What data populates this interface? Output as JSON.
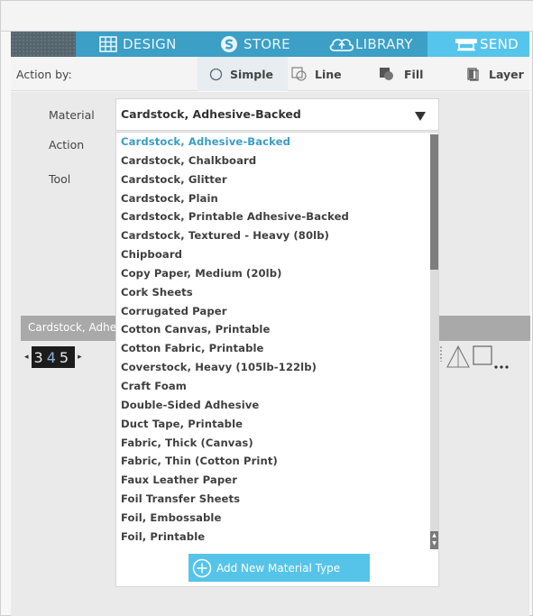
{
  "tabs": [
    {
      "label": "DESIGN",
      "icon": "grid-icon"
    },
    {
      "label": "STORE",
      "icon": "store-icon"
    },
    {
      "label": "LIBRARY",
      "icon": "cloud-icon"
    },
    {
      "label": "SEND",
      "icon": "cutter-icon",
      "active": true
    }
  ],
  "action_bar": {
    "label": "Action by:",
    "options": [
      {
        "label": "Simple",
        "icon": "circle-icon",
        "selected": true
      },
      {
        "label": "Line",
        "icon": "line-icon"
      },
      {
        "label": "Fill",
        "icon": "fill-icon"
      },
      {
        "label": "Layer",
        "icon": "layer-icon"
      }
    ]
  },
  "form": {
    "material_label": "Material",
    "action_label": "Action",
    "tool_label": "Tool",
    "material_value": "Cardstock, Adhesive-Backed"
  },
  "dropdown": {
    "items": [
      "Cardstock, Adhesive-Backed",
      "Cardstock, Chalkboard",
      "Cardstock, Glitter",
      "Cardstock, Plain",
      "Cardstock, Printable Adhesive-Backed",
      "Cardstock, Textured - Heavy (80lb)",
      "Chipboard",
      "Copy Paper, Medium (20lb)",
      "Cork Sheets",
      "Corrugated Paper",
      "Cotton Canvas, Printable",
      "Cotton Fabric, Printable",
      "Coverstock, Heavy (105lb-122lb)",
      "Craft Foam",
      "Double-Sided Adhesive",
      "Duct Tape, Printable",
      "Fabric, Thick (Canvas)",
      "Fabric, Thin (Cotton Print)",
      "Faux Leather Paper",
      "Foil Transfer Sheets",
      "Foil, Embossable",
      "Foil, Printable"
    ],
    "selected_index": 0,
    "add_button": "Add New Material Type"
  },
  "background_bar": {
    "label": "Cardstock, Adhe"
  },
  "numbers": [
    "3",
    "4",
    "5"
  ],
  "colors": {
    "tab_bar": "#3b9fc6",
    "active_tab": "#55c5ec",
    "selected_item": "#3a9dc4",
    "add_button": "#56c4e8"
  }
}
